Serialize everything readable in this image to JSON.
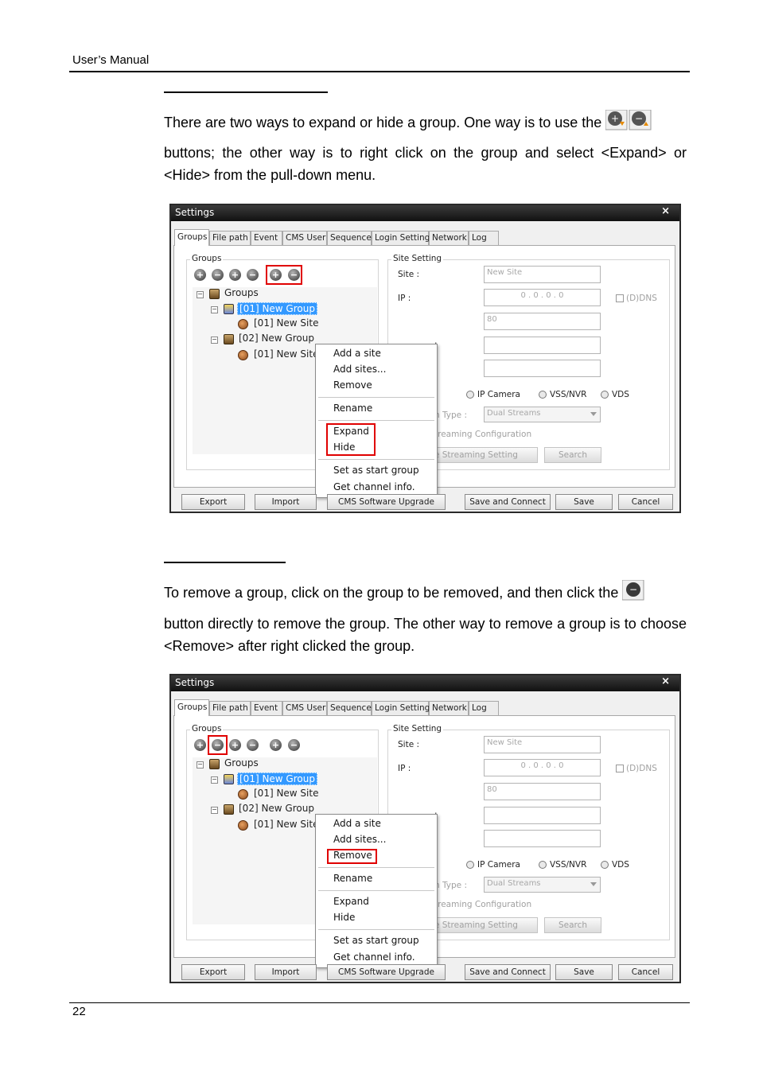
{
  "header": {
    "title": "User’s Manual"
  },
  "section1": {
    "para_a": "There are two ways to expand or hide a group. One way is to use the",
    "para_b": "buttons; the other way is to right click on the group and select <Expand> or <Hide> from the pull-down menu."
  },
  "section2": {
    "para_a": "To remove a group, click on the group to be removed, and then click the",
    "para_b": "button directly to remove the group. The other way to remove a group is to choose <Remove> after right clicked the group."
  },
  "window": {
    "title": "Settings",
    "close": "×",
    "tabs": [
      "Groups",
      "File path",
      "Event",
      "CMS User",
      "Sequence",
      "Login Setting",
      "Network",
      "Log"
    ],
    "groups_caption": "Groups",
    "site_setting_caption": "Site Setting",
    "toolbar_icons": [
      "add-group-icon",
      "remove-group-icon",
      "add-site-icon",
      "remove-site-icon",
      "expand-icon",
      "hide-icon"
    ],
    "tree": {
      "root": "Groups",
      "group1": "[01] New Group",
      "group1_site": "[01] New Site",
      "group2": "[02] New Group",
      "group2_site": "[01] New Site"
    },
    "form": {
      "site_label": "Site :",
      "site_value": "New Site",
      "ip_label": "IP :",
      "ip_value": "0   .   0   .   0   .   0",
      "ddns_label": "(D)DNS",
      "port_value": "80",
      "colon_a": ":",
      "colon_b": ":",
      "radio_ip_camera": "IP Camera",
      "radio_vss_nvr": "VSS/NVR",
      "radio_vds": "VDS",
      "stream_type_label": "n Type :",
      "stream_type_value": "Dual Streams",
      "streaming_config_label": "treaming Configuration",
      "advance_button": "ance Streaming Setting",
      "search_button": "Search"
    },
    "context_menu": {
      "add_site": "Add a site",
      "add_sites": "Add sites...",
      "remove": "Remove",
      "rename": "Rename",
      "expand": "Expand",
      "hide": "Hide",
      "set_start": "Set as start group",
      "get_channel": "Get channel info."
    },
    "buttons": {
      "export": "Export",
      "import": "Import",
      "upgrade": "CMS Software Upgrade",
      "save_connect": "Save and Connect",
      "save": "Save",
      "cancel": "Cancel"
    }
  },
  "footer": {
    "page_number": "22"
  }
}
